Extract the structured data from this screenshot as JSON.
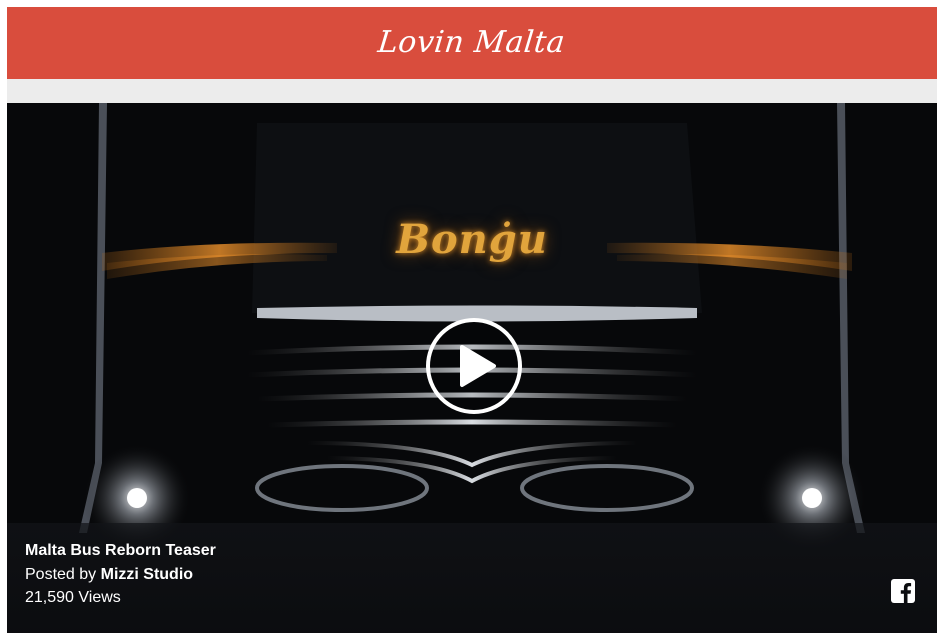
{
  "header": {
    "logo_text": "Lovin Malta",
    "color": "#d94d3d"
  },
  "video": {
    "thumbnail_text": "Bonġu",
    "play_icon": "play-icon",
    "title": "Malta Bus Reborn Teaser",
    "posted_prefix": "Posted by",
    "author": "Mizzi Studio",
    "views": "21,590 Views",
    "share_icon": "facebook-icon"
  }
}
